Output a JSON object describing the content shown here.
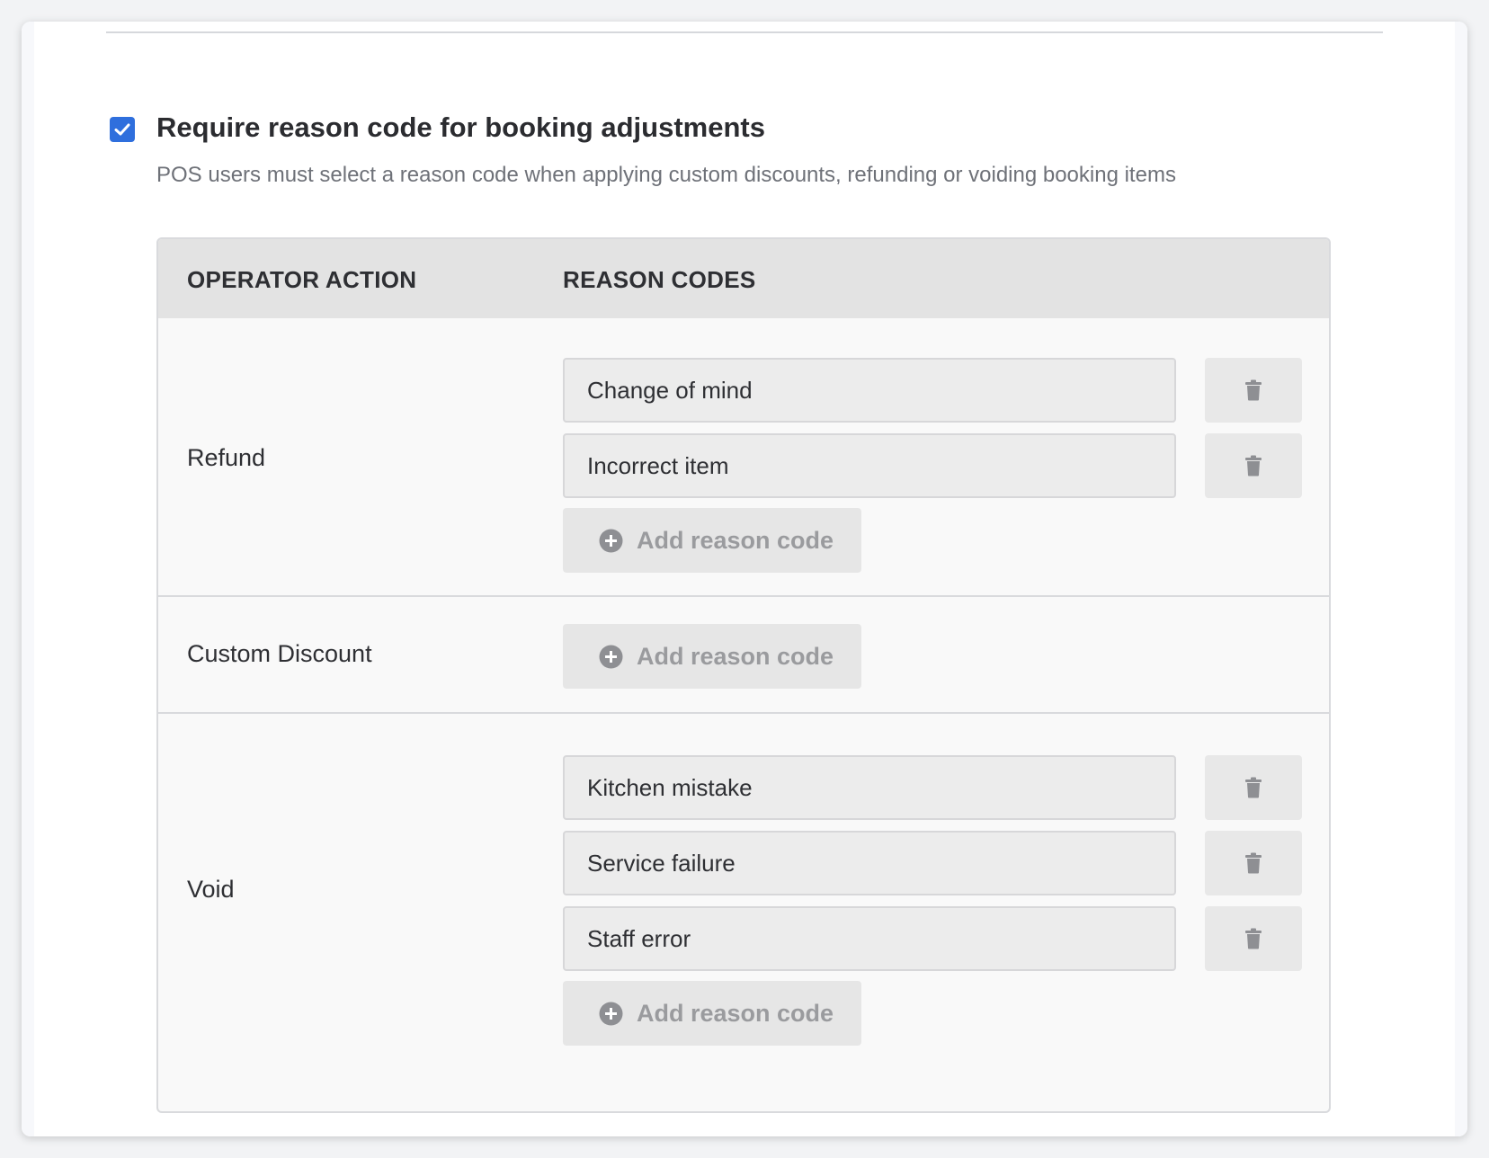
{
  "setting": {
    "checked": true,
    "title": "Require reason code for booking adjustments",
    "description": "POS users must select a reason code when applying custom discounts, refunding or voiding booking items"
  },
  "table": {
    "headers": {
      "action": "OPERATOR ACTION",
      "codes": "REASON CODES"
    },
    "rows": [
      {
        "action": "Refund",
        "codes": [
          "Change of mind",
          "Incorrect item"
        ],
        "add_label": "Add reason code"
      },
      {
        "action": "Custom Discount",
        "codes": [],
        "add_label": "Add reason code"
      },
      {
        "action": "Void",
        "codes": [
          "Kitchen mistake",
          "Service failure",
          "Staff error"
        ],
        "add_label": "Add reason code"
      }
    ]
  },
  "icons": {
    "checkbox": "check-icon",
    "delete": "trash-icon",
    "add": "plus-circle-icon"
  },
  "colors": {
    "accent": "#2f6fdd",
    "icon_gray": "#8e8f93"
  }
}
